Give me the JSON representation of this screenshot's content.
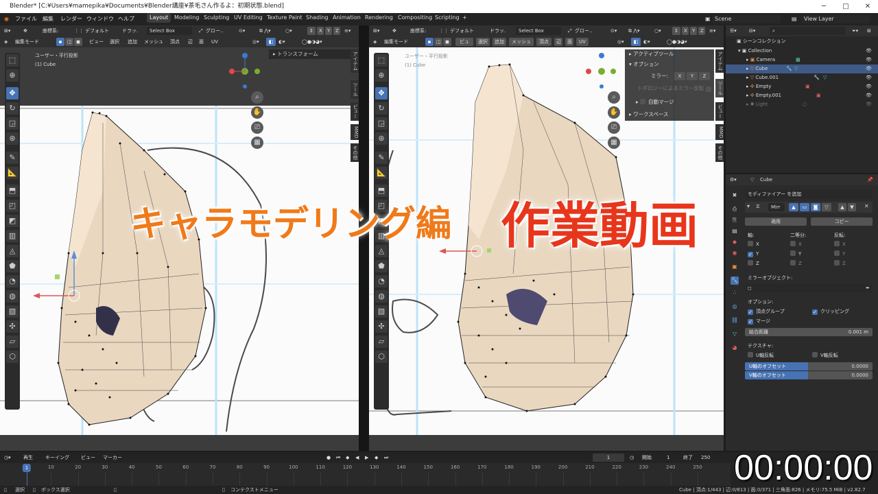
{
  "window": {
    "title": "Blender* [C:¥Users¥mamepika¥Documents¥Blender講座¥茶毛さん作るよ：初期状態.blend]",
    "controls": [
      "─",
      "□",
      "✕"
    ]
  },
  "menu": [
    "ファイル",
    "編集",
    "レンダー",
    "ウィンドウ",
    "ヘルプ"
  ],
  "workspaces": [
    "Layout",
    "Modeling",
    "Sculpting",
    "UV Editing",
    "Texture Paint",
    "Shading",
    "Animation",
    "Rendering",
    "Compositing",
    "Scripting",
    "+"
  ],
  "scene": {
    "scene_label": "Scene",
    "view_layer": "View Layer"
  },
  "viewport_left": {
    "coord_label": "座標系:",
    "coord_value": "デフォルト",
    "drag_label": "ドラッ.",
    "drag_value": "Select Box",
    "orient": "グロー..",
    "mode": "編集モード",
    "menus": [
      "ビュー",
      "選択",
      "追加",
      "メッシュ",
      "頂点",
      "辺",
      "面",
      "UV"
    ],
    "view_name": "ユーザー・平行投影",
    "object": "(1) Cube",
    "n_panel": "トランスフォーム",
    "xyz": [
      "X",
      "Y",
      "Z"
    ],
    "tabs": [
      "アイテム",
      "ツール",
      "ビュー",
      "MMD",
      "その他"
    ]
  },
  "viewport_right": {
    "coord_label": "座標系:",
    "coord_value": "デフォルト",
    "drag_label": "ドラッ.",
    "drag_value": "Select Box",
    "orient": "グロー..",
    "mode": "編集モード",
    "menus": [
      "ビュー",
      "選択",
      "追加",
      "メッシュ",
      "頂点",
      "辺",
      "面",
      "UV"
    ],
    "view_name": "ユーザー・平行投影",
    "object": "(1) Cube",
    "xyz": [
      "X",
      "Y",
      "Z"
    ],
    "tabs": [
      "アイテム",
      "ツール",
      "ビュー",
      "MMD",
      "その他"
    ],
    "panel": {
      "active_tool": "アクティブツール",
      "options": "オプション",
      "mirror_label": "ミラー:",
      "mirror_axes": [
        "X",
        "Y",
        "Z"
      ],
      "topology": "トポロジーによるミラー反転",
      "auto_merge": "自動マージ",
      "workspace": "ワークスペース"
    }
  },
  "outliner": {
    "search_placeholder": "",
    "root": "シーンコレクション",
    "items": [
      {
        "name": "Collection"
      },
      {
        "name": "Camera"
      },
      {
        "name": "Cube"
      },
      {
        "name": "Cube.001"
      },
      {
        "name": "Empty"
      },
      {
        "name": "Empty.001"
      },
      {
        "name": "Light"
      }
    ]
  },
  "properties": {
    "object": "Cube",
    "add_modifier": "モディファイアー を追加",
    "modifier_name": "Mirr",
    "apply": "適用",
    "copy": "コピー",
    "axis_header": "軸:",
    "bisect_header": "二等分:",
    "flip_header": "反転:",
    "axes": [
      "X",
      "Y",
      "Z"
    ],
    "mirror_object": "ミラーオブジェクト:",
    "options": "オプション:",
    "vertex_groups": "頂点グループ",
    "clipping": "クリッピング",
    "merge": "マージ",
    "merge_distance_label": "結合距離",
    "merge_distance_value": "0.001 m",
    "texture": "テクスチャ:",
    "u_flip": "U軸反転",
    "v_flip": "V軸反転",
    "u_offset_label": "U軸のオフセット",
    "u_offset_value": "0.0000",
    "v_offset_label": "V軸のオフセット",
    "v_offset_value": "0.0000"
  },
  "timeline": {
    "menus": [
      "再生",
      "キーイング",
      "ビュー",
      "マーカー"
    ],
    "current_frame": "1",
    "start_label": "開始",
    "start": "1",
    "end_label": "終了",
    "end": "250",
    "ticks": [
      "1",
      "10",
      "20",
      "30",
      "40",
      "50",
      "60",
      "70",
      "80",
      "90",
      "100",
      "110",
      "120",
      "130",
      "140",
      "150",
      "160",
      "170",
      "180",
      "190",
      "200",
      "210",
      "220",
      "230",
      "240",
      "250"
    ],
    "playhead_frame": 1
  },
  "status": {
    "select": "選択",
    "box_select": "ボックス選択",
    "context_menu": "コンテクストメニュー",
    "stats": "Cube | 頂点:1/443 | 辺:0/813 | 面:0/371 | 三角面:826 | メモリ:75.5 MiB | v2.82.7"
  },
  "overlay": {
    "title_left": "キャラモデリング編",
    "title_right": "作業動画",
    "timer": "00:00:00"
  },
  "colors": {
    "accent": "#4772b3",
    "overlay_orange": "#f07a1a",
    "overlay_red": "#e8361c"
  }
}
